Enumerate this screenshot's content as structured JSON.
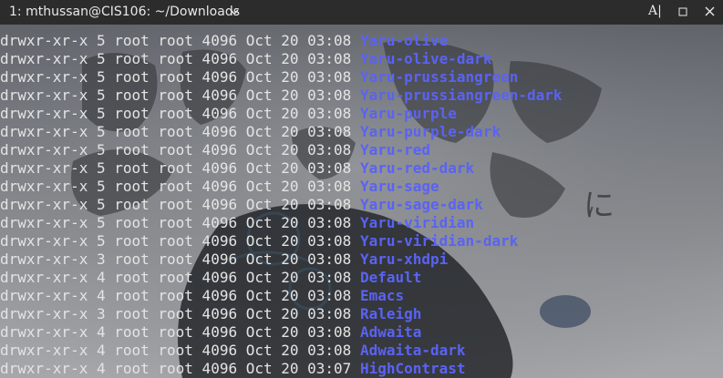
{
  "window": {
    "title": "1: mthussan@CIS106: ~/Downloads",
    "font_control_label": "A̲I",
    "minimize_icon": "minimize-icon",
    "close_icon": "close-icon"
  },
  "colors": {
    "directory": "#5a63f2",
    "text": "#e4e4e4",
    "titlebar": "#2c2c2c"
  },
  "listing": [
    {
      "perms": "drwxr-xr-x",
      "links": "5",
      "owner": "root",
      "group": "root",
      "size": "4096",
      "month": "Oct",
      "day": "20",
      "time": "03:08",
      "name": "Yaru-olive"
    },
    {
      "perms": "drwxr-xr-x",
      "links": "5",
      "owner": "root",
      "group": "root",
      "size": "4096",
      "month": "Oct",
      "day": "20",
      "time": "03:08",
      "name": "Yaru-olive-dark"
    },
    {
      "perms": "drwxr-xr-x",
      "links": "5",
      "owner": "root",
      "group": "root",
      "size": "4096",
      "month": "Oct",
      "day": "20",
      "time": "03:08",
      "name": "Yaru-prussiangreen"
    },
    {
      "perms": "drwxr-xr-x",
      "links": "5",
      "owner": "root",
      "group": "root",
      "size": "4096",
      "month": "Oct",
      "day": "20",
      "time": "03:08",
      "name": "Yaru-prussiangreen-dark"
    },
    {
      "perms": "drwxr-xr-x",
      "links": "5",
      "owner": "root",
      "group": "root",
      "size": "4096",
      "month": "Oct",
      "day": "20",
      "time": "03:08",
      "name": "Yaru-purple"
    },
    {
      "perms": "drwxr-xr-x",
      "links": "5",
      "owner": "root",
      "group": "root",
      "size": "4096",
      "month": "Oct",
      "day": "20",
      "time": "03:08",
      "name": "Yaru-purple-dark"
    },
    {
      "perms": "drwxr-xr-x",
      "links": "5",
      "owner": "root",
      "group": "root",
      "size": "4096",
      "month": "Oct",
      "day": "20",
      "time": "03:08",
      "name": "Yaru-red"
    },
    {
      "perms": "drwxr-xr-x",
      "links": "5",
      "owner": "root",
      "group": "root",
      "size": "4096",
      "month": "Oct",
      "day": "20",
      "time": "03:08",
      "name": "Yaru-red-dark"
    },
    {
      "perms": "drwxr-xr-x",
      "links": "5",
      "owner": "root",
      "group": "root",
      "size": "4096",
      "month": "Oct",
      "day": "20",
      "time": "03:08",
      "name": "Yaru-sage"
    },
    {
      "perms": "drwxr-xr-x",
      "links": "5",
      "owner": "root",
      "group": "root",
      "size": "4096",
      "month": "Oct",
      "day": "20",
      "time": "03:08",
      "name": "Yaru-sage-dark"
    },
    {
      "perms": "drwxr-xr-x",
      "links": "5",
      "owner": "root",
      "group": "root",
      "size": "4096",
      "month": "Oct",
      "day": "20",
      "time": "03:08",
      "name": "Yaru-viridian"
    },
    {
      "perms": "drwxr-xr-x",
      "links": "5",
      "owner": "root",
      "group": "root",
      "size": "4096",
      "month": "Oct",
      "day": "20",
      "time": "03:08",
      "name": "Yaru-viridian-dark"
    },
    {
      "perms": "drwxr-xr-x",
      "links": "3",
      "owner": "root",
      "group": "root",
      "size": "4096",
      "month": "Oct",
      "day": "20",
      "time": "03:08",
      "name": "Yaru-xhdpi"
    },
    {
      "perms": "drwxr-xr-x",
      "links": "4",
      "owner": "root",
      "group": "root",
      "size": "4096",
      "month": "Oct",
      "day": "20",
      "time": "03:08",
      "name": "Default"
    },
    {
      "perms": "drwxr-xr-x",
      "links": "4",
      "owner": "root",
      "group": "root",
      "size": "4096",
      "month": "Oct",
      "day": "20",
      "time": "03:08",
      "name": "Emacs"
    },
    {
      "perms": "drwxr-xr-x",
      "links": "3",
      "owner": "root",
      "group": "root",
      "size": "4096",
      "month": "Oct",
      "day": "20",
      "time": "03:08",
      "name": "Raleigh"
    },
    {
      "perms": "drwxr-xr-x",
      "links": "4",
      "owner": "root",
      "group": "root",
      "size": "4096",
      "month": "Oct",
      "day": "20",
      "time": "03:08",
      "name": "Adwaita"
    },
    {
      "perms": "drwxr-xr-x",
      "links": "4",
      "owner": "root",
      "group": "root",
      "size": "4096",
      "month": "Oct",
      "day": "20",
      "time": "03:08",
      "name": "Adwaita-dark"
    },
    {
      "perms": "drwxr-xr-x",
      "links": "4",
      "owner": "root",
      "group": "root",
      "size": "4096",
      "month": "Oct",
      "day": "20",
      "time": "03:07",
      "name": "HighContrast"
    }
  ]
}
